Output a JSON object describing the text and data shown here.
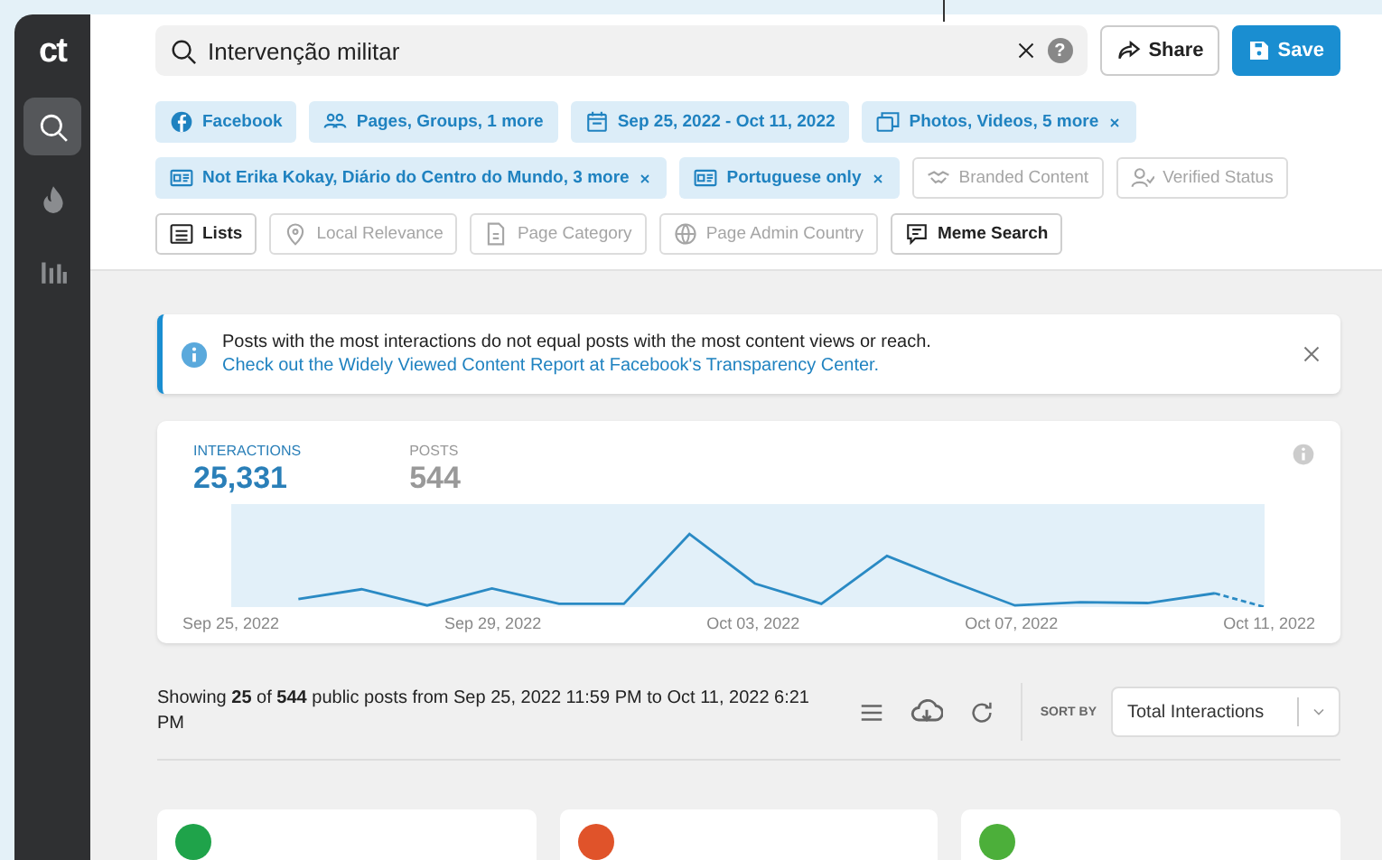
{
  "sidebar": {
    "logo": "ct",
    "items": [
      {
        "selected": true
      },
      {
        "selected": false
      },
      {
        "selected": false
      }
    ]
  },
  "search": {
    "value": "Intervenção militar",
    "help": "?"
  },
  "header_buttons": [
    {
      "label": "Share",
      "kind": "outline"
    },
    {
      "label": "Save",
      "kind": "primary"
    }
  ],
  "filter_rows": [
    [
      {
        "label": "Facebook",
        "kind": "applied",
        "removable": false
      },
      {
        "label": "Pages, Groups, 1 more",
        "kind": "applied",
        "removable": false
      },
      {
        "label": "Sep 25, 2022 - Oct 11, 2022",
        "kind": "applied",
        "removable": false
      },
      {
        "label": "Photos, Videos, 5 more",
        "kind": "applied",
        "removable": true
      }
    ],
    [
      {
        "label": "Not Erika Kokay, Diário do Centro do Mundo, 3 more",
        "kind": "applied",
        "removable": true
      },
      {
        "label": "Portuguese only",
        "kind": "applied",
        "removable": true
      },
      {
        "label": "Branded Content",
        "kind": "available",
        "removable": false
      },
      {
        "label": "Verified Status",
        "kind": "available",
        "removable": false
      }
    ],
    [
      {
        "label": "Lists",
        "kind": "tool",
        "removable": false
      },
      {
        "label": "Local Relevance",
        "kind": "available",
        "removable": false
      },
      {
        "label": "Page Category",
        "kind": "available",
        "removable": false
      },
      {
        "label": "Page Admin Country",
        "kind": "available",
        "removable": false
      },
      {
        "label": "Meme Search",
        "kind": "tool",
        "removable": false
      }
    ]
  ],
  "notice": {
    "text": "Posts with the most interactions do not equal posts with the most content views or reach.",
    "link": "Check out the Widely Viewed Content Report at Facebook's Transparency Center."
  },
  "summary": {
    "metrics": [
      {
        "label": "INTERACTIONS",
        "value": "25,331",
        "selected": true
      },
      {
        "label": "POSTS",
        "value": "544",
        "selected": false
      }
    ],
    "x_labels": [
      "Sep 25, 2022",
      "Sep 29, 2022",
      "Oct 03, 2022",
      "Oct 07, 2022",
      "Oct 11, 2022"
    ]
  },
  "results": {
    "text": "Showing **25** of **544** public posts from Sep 25, 2022 11:59 PM to Oct 11, 2022 6:21 PM",
    "sort_label": "SORT BY",
    "sort_value": "Total Interactions"
  },
  "post_cards": [
    {
      "color": "#1fa34a"
    },
    {
      "color": "#e0532a"
    },
    {
      "color": "#4caf3a"
    }
  ]
}
